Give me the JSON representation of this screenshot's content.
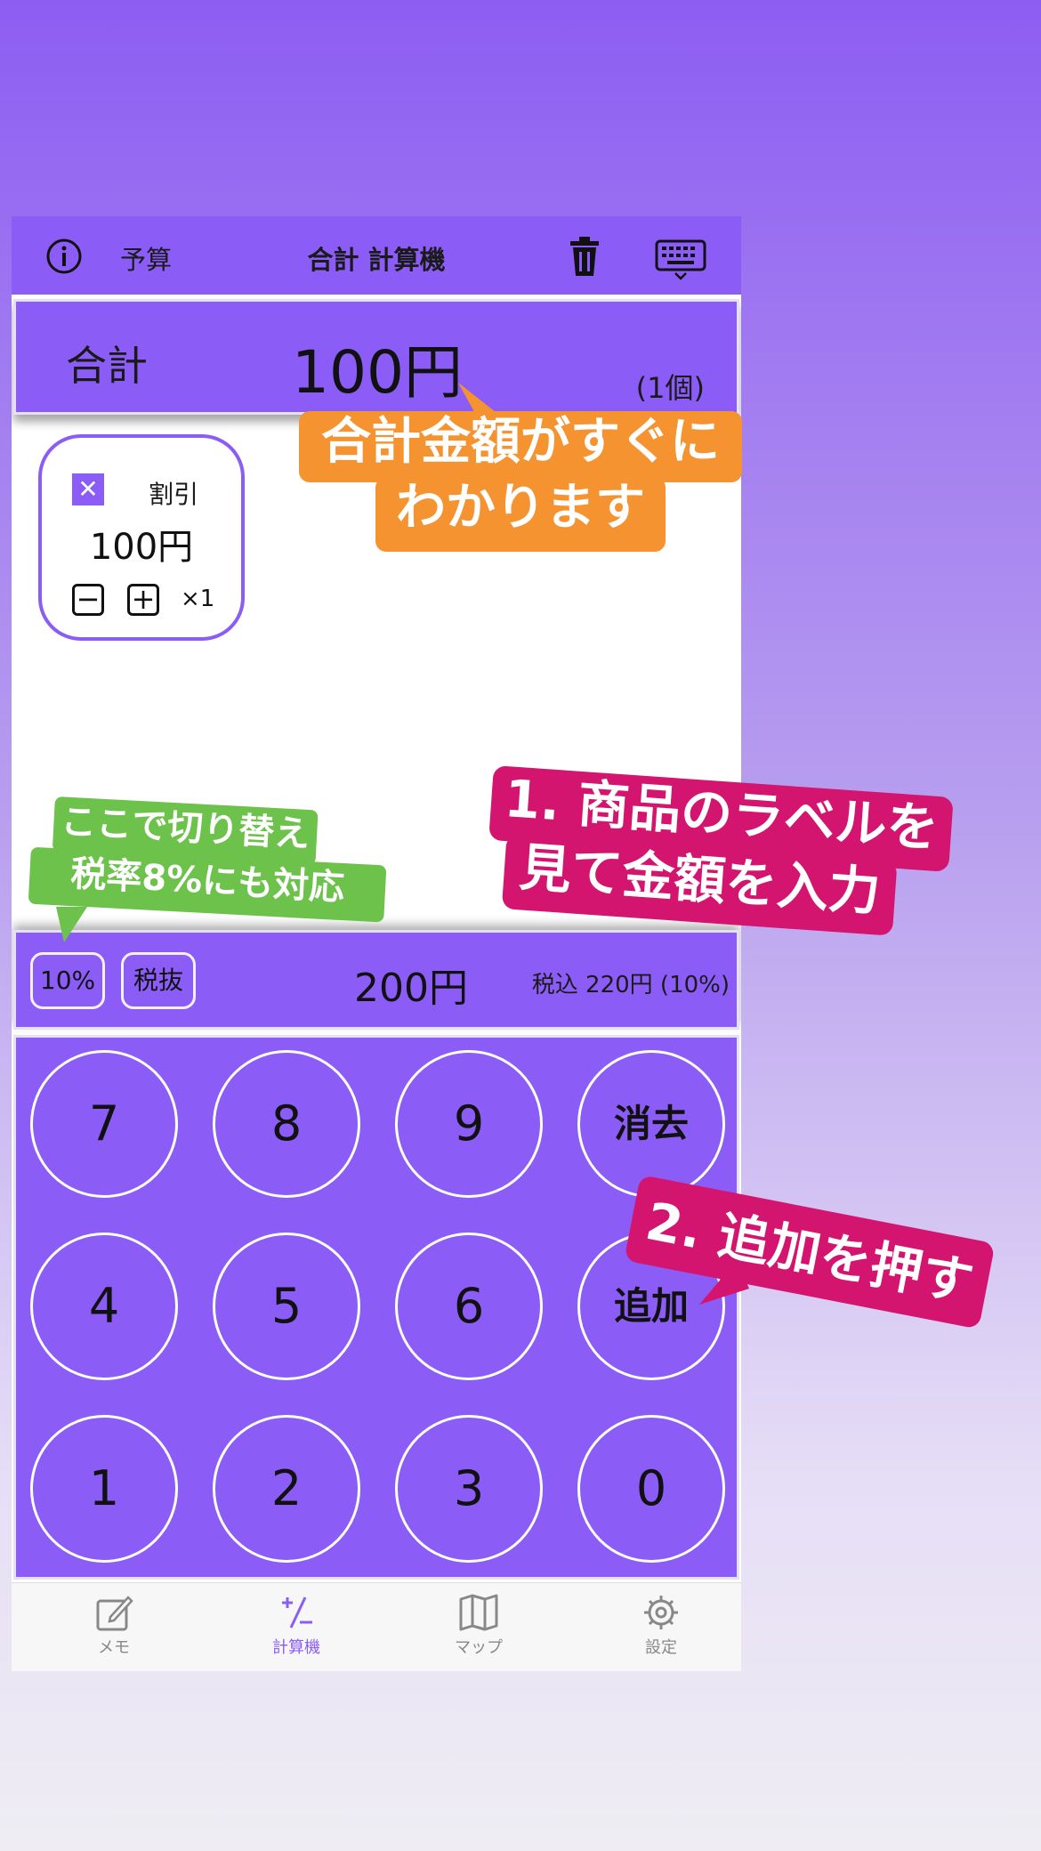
{
  "nav": {
    "budget_label": "予算",
    "title": "合計 計算機"
  },
  "total": {
    "label": "合計",
    "amount": "100円",
    "count": "(1個)"
  },
  "item": {
    "name": "割引",
    "price": "100円",
    "remove": "✕",
    "minus": "−",
    "plus": "+",
    "qty": "×1"
  },
  "input_bar": {
    "rate_button": "10%",
    "tax_mode_button": "税抜",
    "amount": "200円",
    "taxed": "税込 220円 (10%)"
  },
  "keypad": {
    "keys": [
      "7",
      "8",
      "9",
      "消去",
      "4",
      "5",
      "6",
      "追加",
      "1",
      "2",
      "3",
      "0"
    ]
  },
  "tabs": [
    {
      "label": "メモ",
      "icon": "memo-icon"
    },
    {
      "label": "計算機",
      "icon": "calculator-icon"
    },
    {
      "label": "マップ",
      "icon": "map-icon"
    },
    {
      "label": "設定",
      "icon": "gear-icon"
    }
  ],
  "callouts": {
    "total_line1": "合計金額がすぐに",
    "total_line2": "わかります",
    "step1_line1": "1. 商品のラベルを",
    "step1_line2": "見て金額を入力",
    "switch_line1": "ここで切り替え",
    "switch_line2": "税率8%にも対応",
    "step2": "2. 追加を押す"
  },
  "colors": {
    "accent": "#8b5cf6",
    "callout_orange": "#f59331",
    "callout_magenta": "#d3156f",
    "callout_green": "#6cc24a"
  }
}
